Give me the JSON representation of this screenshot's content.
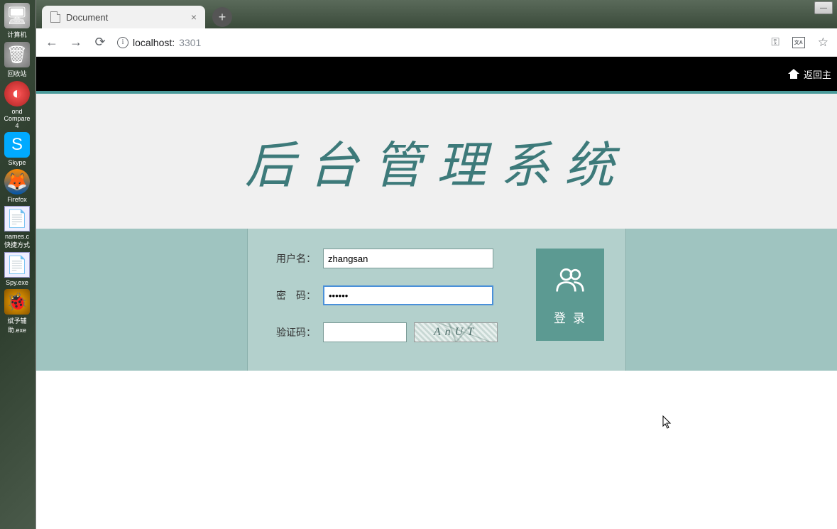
{
  "desktop": {
    "icons": [
      {
        "label": "计算机"
      },
      {
        "label": "回收站"
      },
      {
        "label": "ond Compare 4"
      },
      {
        "label": "Skype"
      },
      {
        "label": "Firefox"
      },
      {
        "label": "names.c 快捷方式"
      },
      {
        "label": "Spy.exe"
      },
      {
        "label": "斌予辅助.exe"
      }
    ]
  },
  "browser": {
    "tab_title": "Document",
    "url_host": "localhost:",
    "url_port": "3301"
  },
  "page": {
    "return_link": "返回主",
    "title": "后台管理系统",
    "form": {
      "username_label": "用户名：",
      "username_value": "zhangsan",
      "password_label": "密　码：",
      "password_value": "••••••",
      "captcha_label": "验证码：",
      "captcha_value": "",
      "captcha_image_text": "AnUT",
      "login_button": "登录"
    }
  }
}
